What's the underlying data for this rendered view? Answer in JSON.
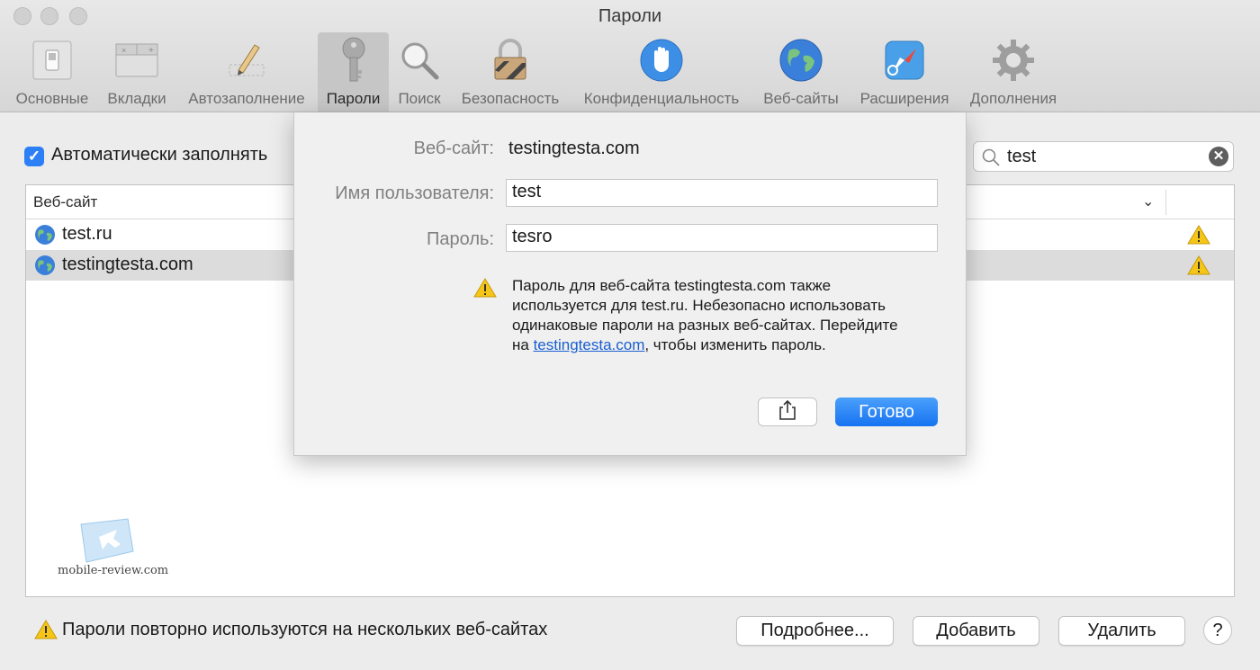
{
  "window": {
    "title": "Пароли"
  },
  "toolbar": {
    "items": [
      {
        "label": "Основные",
        "icon": "general-switch-icon"
      },
      {
        "label": "Вкладки",
        "icon": "tabs-icon"
      },
      {
        "label": "Автозаполнение",
        "icon": "autofill-pencil-icon"
      },
      {
        "label": "Пароли",
        "icon": "key-icon",
        "active": true
      },
      {
        "label": "Поиск",
        "icon": "magnifier-icon"
      },
      {
        "label": "Безопасность",
        "icon": "lock-icon"
      },
      {
        "label": "Конфиденциальность",
        "icon": "hand-icon"
      },
      {
        "label": "Веб-сайты",
        "icon": "globe-icon"
      },
      {
        "label": "Расширения",
        "icon": "compass-icon"
      },
      {
        "label": "Дополнения",
        "icon": "gear-icon"
      }
    ]
  },
  "main": {
    "autofill_checkbox": {
      "label": "Автоматически заполнять",
      "checked": true
    },
    "search": {
      "value": "test"
    },
    "table": {
      "column_site": "Веб-сайт",
      "rows": [
        {
          "site": "test.ru",
          "warning": true,
          "selected": false
        },
        {
          "site": "testingtesta.com",
          "warning": true,
          "selected": true
        }
      ]
    },
    "watermark": "mobile-review.com",
    "bottom": {
      "warning_text": "Пароли повторно используются на нескольких веб-сайтах",
      "details_button": "Подробнее...",
      "add_button": "Добавить",
      "delete_button": "Удалить",
      "help_button": "?"
    }
  },
  "sheet": {
    "website_label": "Веб-сайт:",
    "website_value": "testingtesta.com",
    "username_label": "Имя пользователя:",
    "username_value": "test",
    "password_label": "Пароль:",
    "password_value": "tesro",
    "warning_part1": "Пароль для веб-сайта testingtesta.com также используется для test.ru. Небезопасно использовать одинаковые пароли на разных веб-сайтах. Перейдите на ",
    "warning_link": "testingtesta.com",
    "warning_part2": ", чтобы изменить пароль.",
    "done_button": "Готово"
  },
  "colors": {
    "accent": "#2d7ff6",
    "warning": "#f5c518",
    "link": "#1a5fd0"
  }
}
